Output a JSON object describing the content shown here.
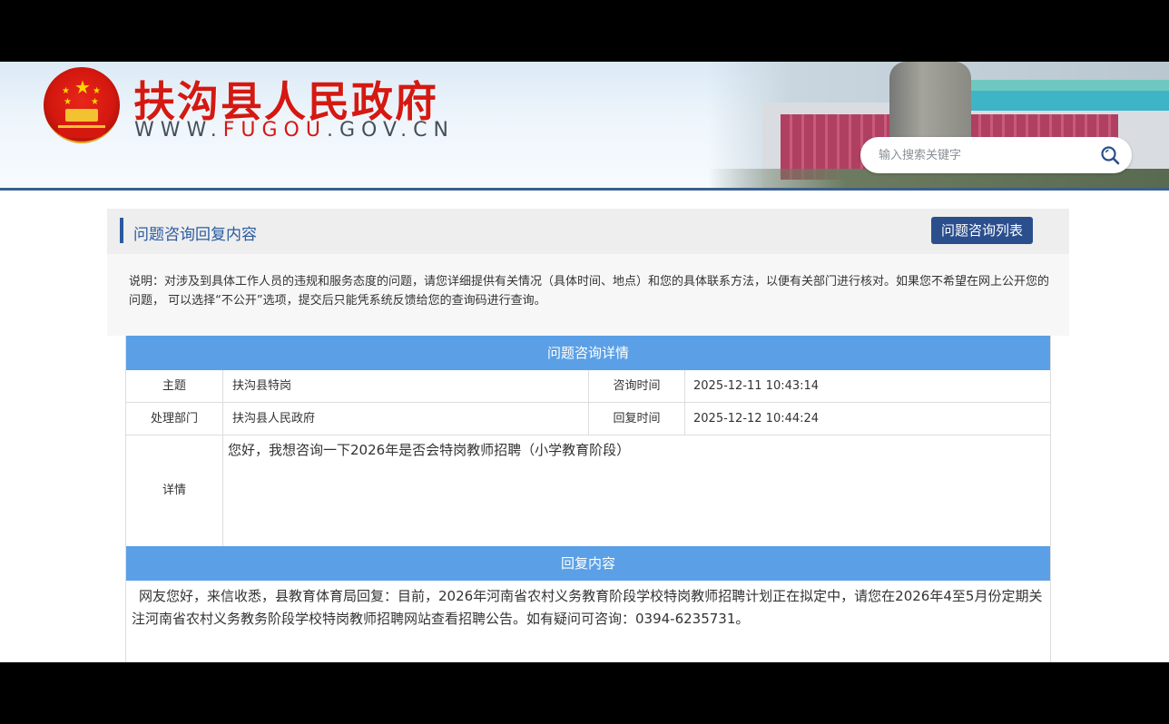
{
  "header": {
    "site_title": "扶沟县人民政府",
    "site_url_prefix": "WWW.",
    "site_url_accent": "FUGOU",
    "site_url_suffix": ".GOV.CN",
    "search": {
      "placeholder": "输入搜索关键字"
    }
  },
  "page": {
    "heading": "问题咨询回复内容",
    "list_button": "问题咨询列表",
    "notice": "说明：对涉及到具体工作人员的违规和服务态度的问题，请您详细提供有关情况（具体时间、地点）和您的具体联系方法，以便有关部门进行核对。如果您不希望在网上公开您的问题， 可以选择“不公开”选项，提交后只能凭系统反馈给您的查询码进行查询。"
  },
  "detail": {
    "section_title": "问题咨询详情",
    "subject_label": "主题",
    "subject_value": "扶沟县特岗",
    "ask_time_label": "咨询时间",
    "ask_time_value": "2025-12-11 10:43:14",
    "dept_label": "处理部门",
    "dept_value": "扶沟县人民政府",
    "reply_time_label": "回复时间",
    "reply_time_value": "2025-12-12 10:44:24",
    "content_label": "详情",
    "content_value": "您好，我想咨询一下2026年是否会特岗教师招聘（小学教育阶段）"
  },
  "reply": {
    "section_title": "回复内容",
    "text": "网友您好，来信收悉，县教育体育局回复：目前，2026年河南省农村义务教育阶段学校特岗教师招聘计划正在拟定中，请您在2026年4至5月份定期关注河南省农村义务教务阶段学校特岗教师招聘网站查看招聘公告。如有疑问可咨询：0394-6235731。"
  },
  "colors": {
    "brand_red": "#d41912",
    "nav_blue": "#2b4f8d",
    "section_blue": "#5ba0e6"
  },
  "icons": [
    "national-emblem-icon",
    "search-icon"
  ]
}
